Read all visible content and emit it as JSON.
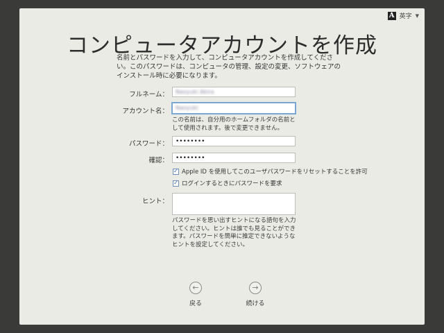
{
  "input_menu": {
    "label": "英字"
  },
  "page": {
    "title": "コンピュータアカウントを作成",
    "description": "名前とパスワードを入力して、コンピュータアカウントを作成してください。このパスワードは、コンピュータの管理、設定の変更、ソフトウェアのインストール時に必要になります。"
  },
  "form": {
    "full_name": {
      "label": "フルネーム：",
      "value": "Naoyuki Akira"
    },
    "account_name": {
      "label": "アカウント名：",
      "value": "Naoyuki",
      "note": "この名前は、自分用のホームフォルダの名前として使用されます。後で変更できません。"
    },
    "password": {
      "label": "パスワード：",
      "value": "••••••••"
    },
    "confirm": {
      "label": "確認：",
      "value": "••••••••"
    },
    "checkbox_apple_id": {
      "label": "Apple ID を使用してこのユーザパスワードをリセットすることを許可",
      "checked": true
    },
    "checkbox_login": {
      "label": "ログインするときにパスワードを要求",
      "checked": true
    },
    "hint": {
      "label": "ヒント：",
      "value": "",
      "note": "パスワードを思い出すヒントになる語句を入力してください。ヒントは誰でも見ることができます。パスワードを簡単に推定できないようなヒントを設定してください。"
    }
  },
  "nav": {
    "back_label": "戻る",
    "continue_label": "続ける"
  }
}
